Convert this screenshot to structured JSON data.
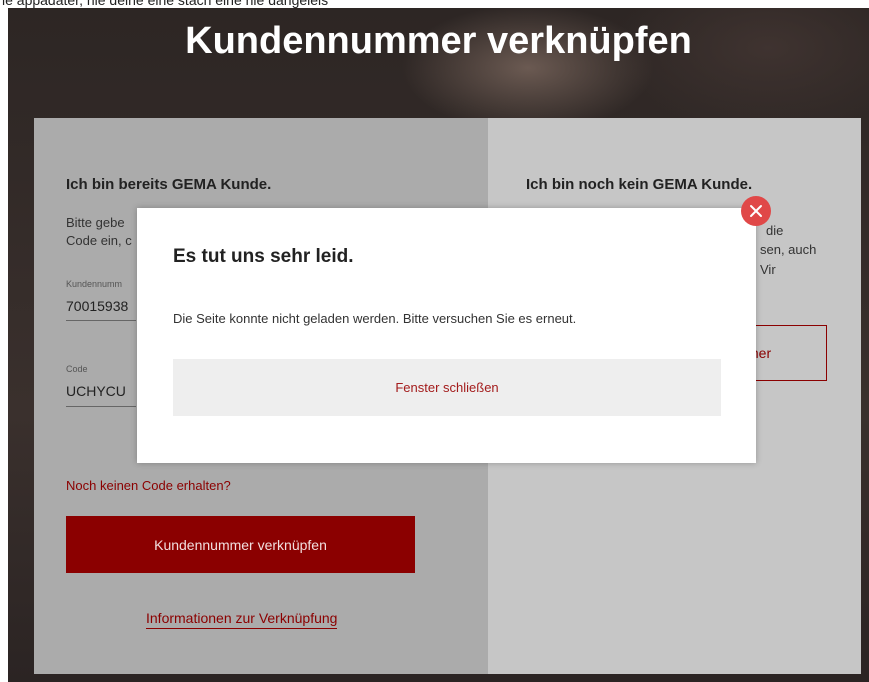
{
  "top_clipped_text": "le appadater, nie deine eine stach eine nie dangeleis",
  "header": {
    "title": "Kundennummer verknüpfen"
  },
  "left": {
    "heading": "Ich bin bereits GEMA Kunde.",
    "desc_line1": "Bitte gebe",
    "desc_line2": "Code ein, c",
    "field_customer_label": "Kundennumm",
    "field_customer_value": "70015938",
    "field_code_label": "Code",
    "field_code_value": "UCHYCU",
    "no_code_link": "Noch keinen Code erhalten?",
    "link_button": "Kundennummer verknüpfen",
    "info_link": "Informationen zur Verknüpfung"
  },
  "right": {
    "heading": "Ich bin noch kein GEMA Kunde.",
    "frag1": "die",
    "frag2": "sen, auch",
    "frag3": "Vir",
    "button_fragment": "mer"
  },
  "modal": {
    "title": "Es tut uns sehr leid.",
    "message": "Die Seite konnte nicht geladen werden. Bitte versuchen Sie es erneut.",
    "close_button": "Fenster schließen"
  },
  "colors": {
    "brand_red": "#8b0000",
    "close_red": "#e04848"
  },
  "icons": {
    "close": "close-icon"
  }
}
